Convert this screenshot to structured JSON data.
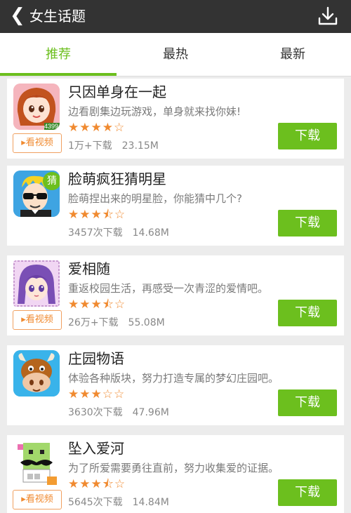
{
  "header": {
    "back_glyph": "❮",
    "title": "女生话题",
    "download_icon": "download-icon"
  },
  "tabs": [
    {
      "label": "推荐",
      "active": true
    },
    {
      "label": "最热",
      "active": false
    },
    {
      "label": "最新",
      "active": false
    }
  ],
  "accent_color": "#6cbf1e",
  "video_label": "▸看视频",
  "download_label": "下载",
  "apps": [
    {
      "name": "只因单身在一起",
      "desc": "边看剧集边玩游戏，单身就来找你妹!",
      "stars": "★★★★☆",
      "rating": 4.0,
      "downloads": "1万+下载",
      "size": "23.15M",
      "has_video": true,
      "icon_text": "4399"
    },
    {
      "name": "脸萌疯狂猜明星",
      "desc": "脸萌捏出来的明星脸，你能猜中几个?",
      "stars": "★★★⯪☆",
      "rating": 3.5,
      "downloads": "3457次下载",
      "size": "14.68M",
      "has_video": false,
      "icon_text": "猜"
    },
    {
      "name": "爱相随",
      "desc": "重返校园生活，再感受一次青涩的爱情吧。",
      "stars": "★★★⯪☆",
      "rating": 3.5,
      "downloads": "26万+下载",
      "size": "55.08M",
      "has_video": true,
      "icon_text": ""
    },
    {
      "name": "庄园物语",
      "desc": "体验各种版块，努力打造专属的梦幻庄园吧。",
      "stars": "★★★☆☆",
      "rating": 3.0,
      "downloads": "3630次下载",
      "size": "47.96M",
      "has_video": false,
      "icon_text": ""
    },
    {
      "name": "坠入爱河",
      "desc": "为了所爱需要勇往直前，努力收集爱的证据。",
      "stars": "★★★⯪☆",
      "rating": 3.5,
      "downloads": "5645次下载",
      "size": "14.84M",
      "has_video": true,
      "icon_text": ""
    }
  ]
}
